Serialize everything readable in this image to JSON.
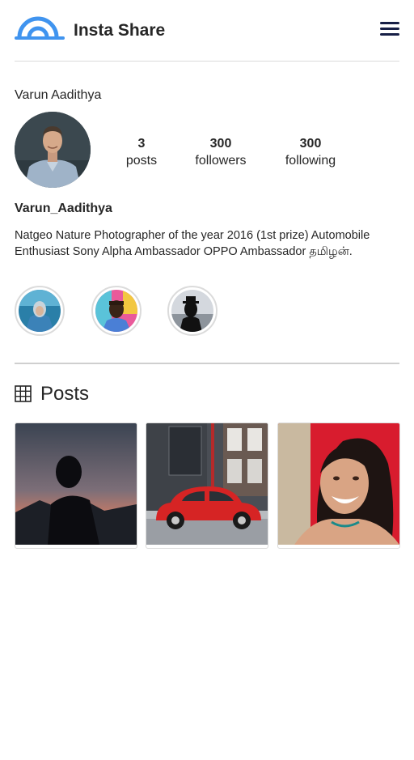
{
  "header": {
    "app_title": "Insta Share",
    "logo_icon": "arch-logo-icon",
    "menu_icon": "hamburger-menu-icon",
    "accent_color": "#4094ef"
  },
  "profile": {
    "name": "Varun Aadithya",
    "username": "Varun_Aadithya",
    "bio": "Natgeo Nature Photographer of the year 2016 (1st prize) Automobile Enthusiast Sony Alpha Ambassador OPPO Ambassador தமிழன்.",
    "stats": [
      {
        "count": "3",
        "label": "posts"
      },
      {
        "count": "300",
        "label": "followers"
      },
      {
        "count": "300",
        "label": "following"
      }
    ]
  },
  "stories": [
    {
      "name": "story-1"
    },
    {
      "name": "story-2"
    },
    {
      "name": "story-3"
    }
  ],
  "posts_section": {
    "title": "Posts",
    "icon": "grid-icon"
  },
  "posts": [
    {
      "name": "post-silhouette"
    },
    {
      "name": "post-red-car"
    },
    {
      "name": "post-smiling-woman"
    }
  ]
}
